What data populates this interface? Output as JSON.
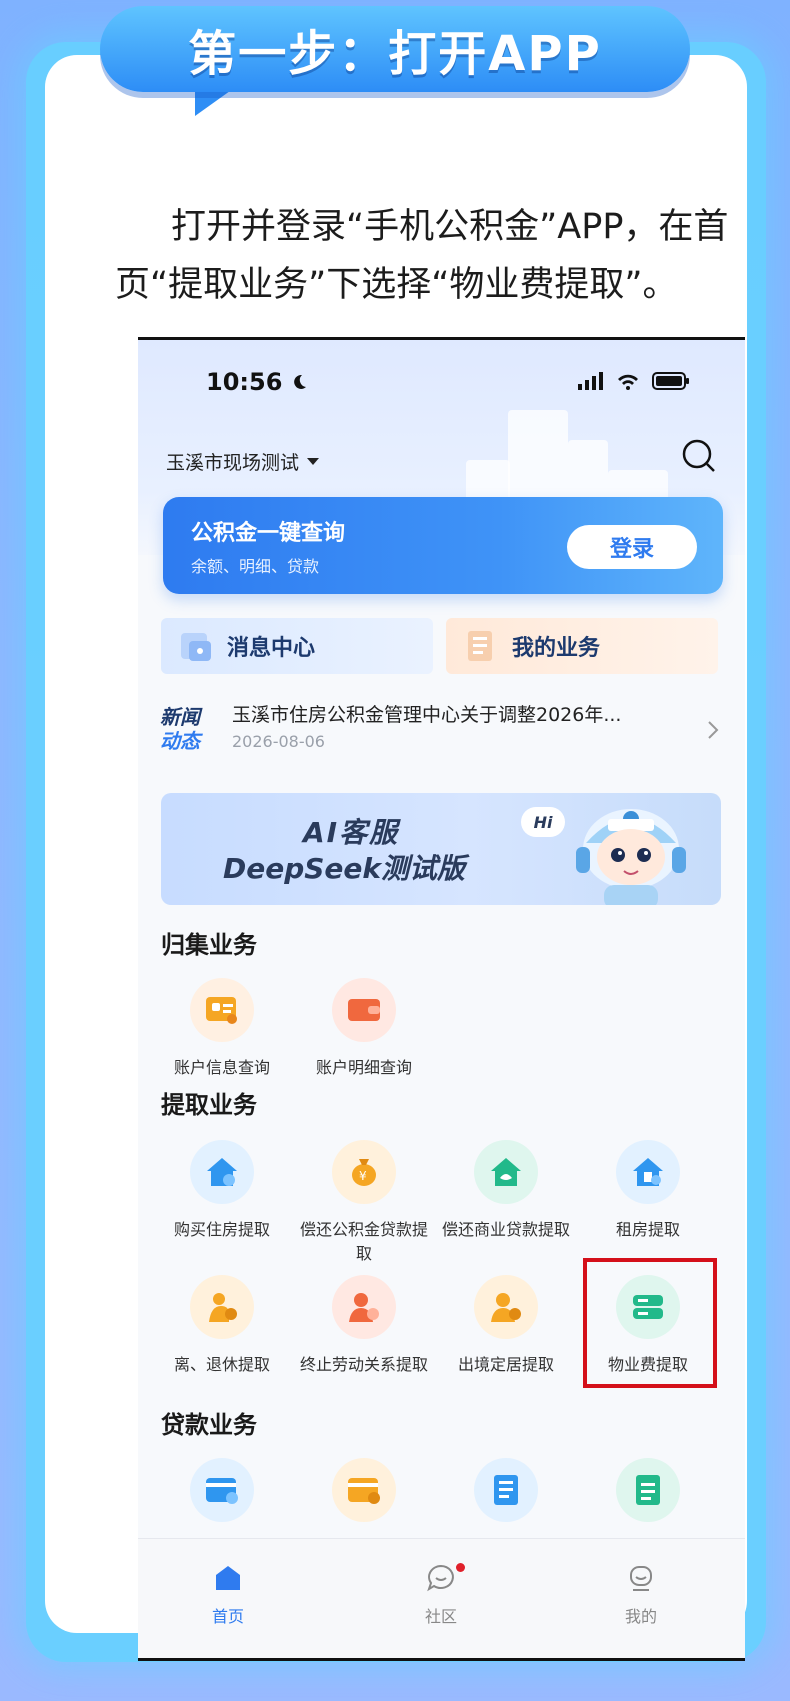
{
  "banner": {
    "title": "第一步：打开APP"
  },
  "instruction": "打开并登录“手机公积金”APP，在首页“提取业务”下选择“物业费提取”。",
  "phone": {
    "status_time": "10:56",
    "city": "玉溪市现场测试",
    "query_card": {
      "title": "公积金一键查询",
      "subtitle": "余额、明细、贷款",
      "login": "登录"
    },
    "quick_links": {
      "messages": "消息中心",
      "my_business": "我的业务"
    },
    "news": {
      "tag_line1": "新闻",
      "tag_line2": "动态",
      "title": "玉溪市住房公积金管理中心关于调整2026年...",
      "date": "2026-08-06"
    },
    "ai_banner": {
      "line1": "AI客服",
      "line2": "DeepSeek测试版",
      "bubble": "Hi"
    },
    "sections": {
      "collection": {
        "title": "归集业务",
        "items": [
          "账户信息查询",
          "账户明细查询"
        ]
      },
      "withdrawal": {
        "title": "提取业务",
        "items": [
          "购买住房提取",
          "偿还公积金贷款提取",
          "偿还商业贷款提取",
          "租房提取",
          "离、退休提取",
          "终止劳动关系提取",
          "出境定居提取",
          "物业费提取"
        ]
      },
      "loan": {
        "title": "贷款业务"
      }
    },
    "tabs": {
      "home": "首页",
      "community": "社区",
      "mine": "我的"
    }
  },
  "colors": {
    "accent": "#2f7bef",
    "highlight": "#d4101a",
    "banner": "#2d8df6"
  }
}
